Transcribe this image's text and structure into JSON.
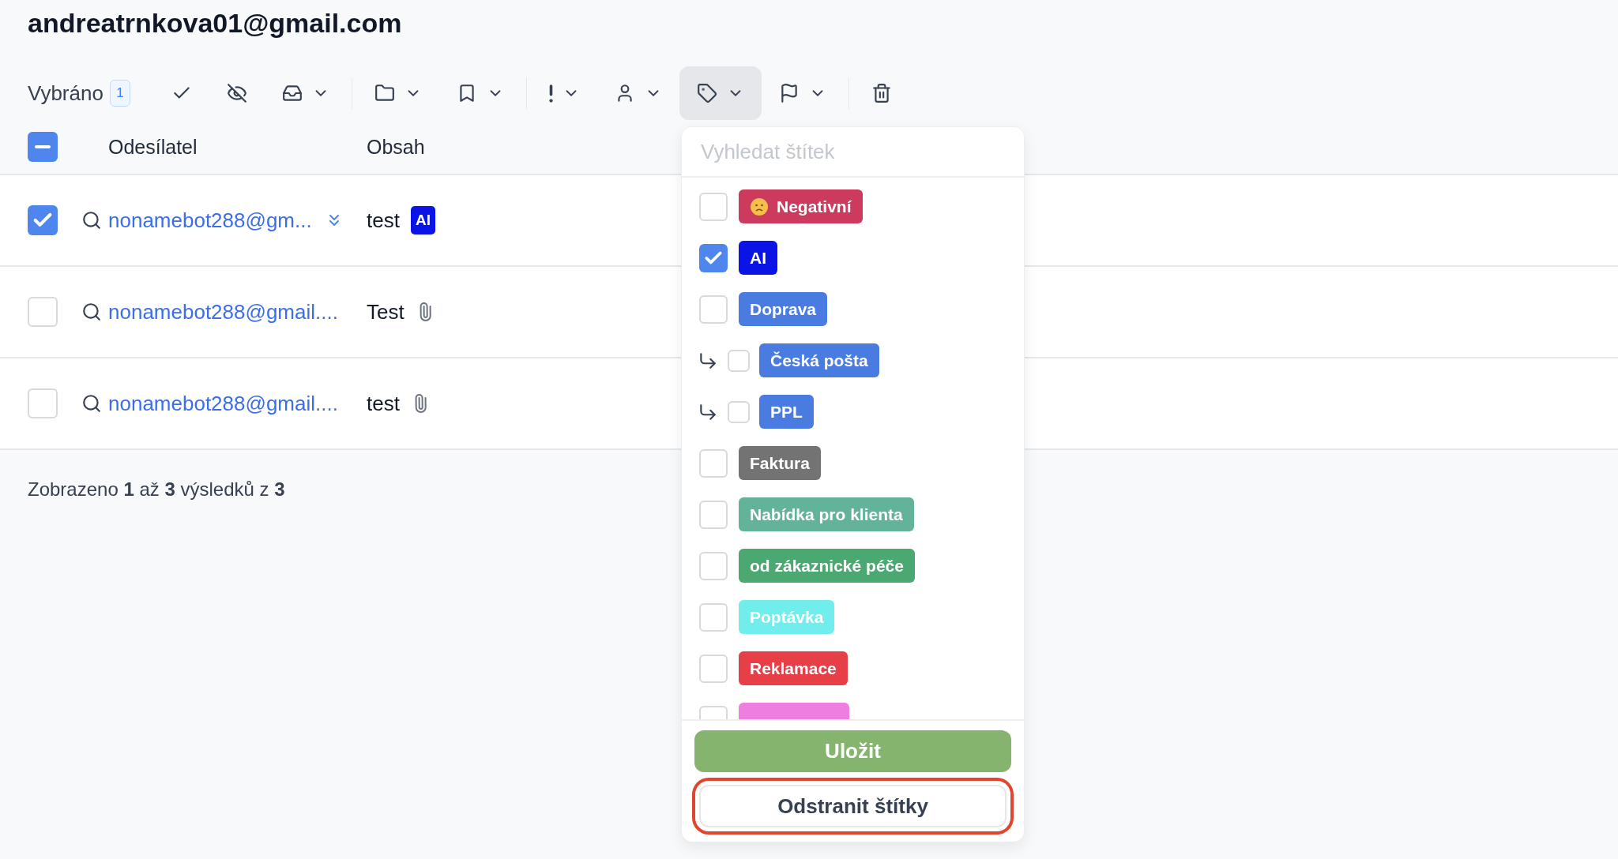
{
  "account": {
    "title": "andreatrnkova01@gmail.com"
  },
  "toolbar": {
    "label": "Vybráno",
    "count": "1",
    "buttons": [
      {
        "menu": false,
        "active": false
      },
      {
        "menu": false,
        "active": false
      },
      {
        "menu": true,
        "active": false
      },
      {
        "menu": true,
        "active": false
      },
      {
        "menu": true,
        "active": false
      },
      {
        "menu": true,
        "active": false
      },
      {
        "menu": true,
        "active": false
      },
      {
        "menu": true,
        "active": true
      },
      {
        "menu": true,
        "active": false
      },
      {
        "menu": false,
        "active": false
      }
    ]
  },
  "table": {
    "select_all": {
      "checked": true,
      "partial": true
    },
    "columns": [
      "Odesílatel",
      "Obsah"
    ],
    "rows": [
      {
        "checked": true,
        "sender": "nonamebot288@gm...",
        "thread": true,
        "subject": "test",
        "attachment": false,
        "tags": [
          {
            "label": "AI",
            "color": "#0a14e6"
          }
        ]
      },
      {
        "checked": false,
        "sender": "nonamebot288@gmail....",
        "thread": false,
        "subject": "Test",
        "attachment": true,
        "tags": []
      },
      {
        "checked": false,
        "sender": "nonamebot288@gmail....",
        "thread": false,
        "subject": "test",
        "attachment": true,
        "tags": []
      }
    ]
  },
  "footer": "Zobrazeno **1** až **3** výsledků z **3**",
  "tag_menu": {
    "search": {
      "placeholder": "Vyhledat štítek"
    },
    "tags": [
      {
        "label": "Negativní",
        "color": "#cc3a5e",
        "kind": "emoji",
        "checked": false
      },
      {
        "label": "AI",
        "color": "#0a14e6",
        "kind": "plain",
        "checked": true
      },
      {
        "label": "Doprava",
        "color": "#4a7be0",
        "kind": "plain",
        "checked": false,
        "children": [
          {
            "label": "Česká pošta",
            "color": "#4a7be0",
            "kind": "plain",
            "checked": false
          },
          {
            "label": "PPL",
            "color": "#4a7be0",
            "kind": "plain",
            "checked": false
          }
        ]
      },
      {
        "label": "Faktura",
        "color": "#737373",
        "kind": "plain",
        "checked": false
      },
      {
        "label": "Nabídka pro klienta",
        "color": "#63b29a",
        "kind": "plain",
        "checked": false
      },
      {
        "label": "od zákaznické péče",
        "color": "#4ba870",
        "kind": "plain",
        "checked": false
      },
      {
        "label": "Poptávka",
        "color": "#6feeed",
        "kind": "plain",
        "checked": false
      },
      {
        "label": "Reklamace",
        "color": "#e63f47",
        "kind": "plain",
        "checked": false
      },
      {
        "color": "#ee7ee0",
        "kind": "cut",
        "checked": false
      }
    ],
    "save_button": "Uložit",
    "remove_button": {
      "label": "Odstranit štítky",
      "highlighted": true
    }
  }
}
